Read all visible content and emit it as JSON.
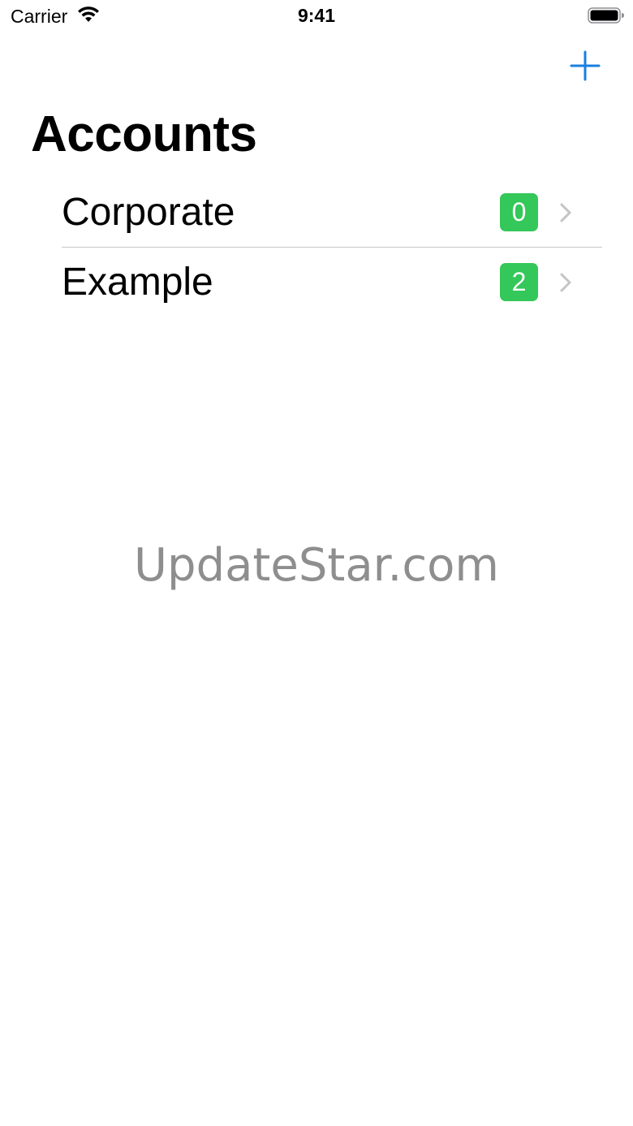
{
  "status_bar": {
    "carrier": "Carrier",
    "time": "9:41",
    "wifi_icon": "wifi-icon",
    "battery_icon": "battery-icon"
  },
  "nav": {
    "add_icon": "plus-icon",
    "accent_color": "#1a7fe0"
  },
  "title": "Accounts",
  "accounts": [
    {
      "label": "Corporate",
      "count": "0"
    },
    {
      "label": "Example",
      "count": "2"
    }
  ],
  "badge_color": "#34c759",
  "watermark": "UpdateStar.com"
}
